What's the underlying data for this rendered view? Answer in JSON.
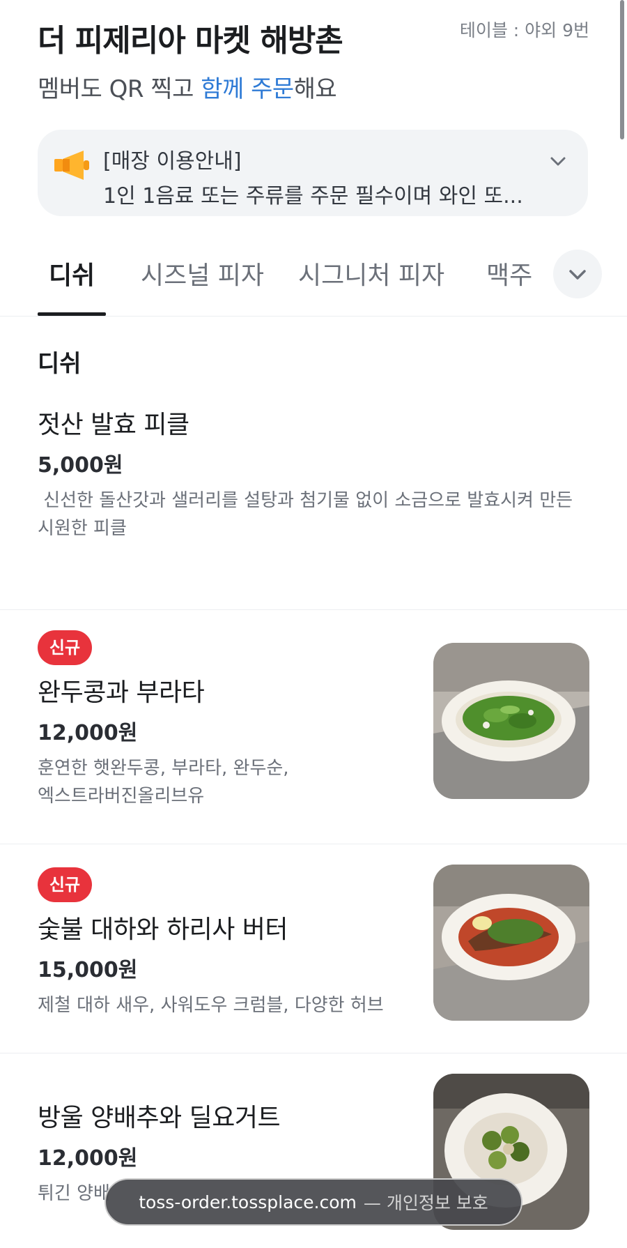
{
  "store": {
    "name": "더 피제리아 마켓 해방촌",
    "table": "테이블 : 야외 9번",
    "subtitle_prefix": "멤버도 QR 찍고 ",
    "subtitle_accent": "함께 주문",
    "subtitle_suffix": "해요"
  },
  "notice": {
    "icon": "megaphone-icon",
    "heading": "[매장 이용안내]",
    "body": "1인 1음료 또는 주류를 주문 필수이며 와인 또...",
    "expand_icon": "chevron-down-icon"
  },
  "tabs": [
    {
      "label": "디쉬",
      "active": true
    },
    {
      "label": "시즈널 피자",
      "active": false
    },
    {
      "label": "시그니처 피자",
      "active": false
    },
    {
      "label": "맥주",
      "active": false
    }
  ],
  "section": {
    "title": "디쉬"
  },
  "items": [
    {
      "name": "젓산 발효 피클",
      "price": "5,000원",
      "desc_line1": " 신선한 돌산갓과 샐러리를 설탕과 첨기물 없이 소금으로 발효시켜 만든",
      "desc_line2": "시원한 피클"
    },
    {
      "badge": "신규",
      "name": "완두콩과 부라타",
      "price": "12,000원",
      "desc_line1": "훈연한 햇완두콩, 부라타, 완두순,",
      "desc_line2": "엑스트라버진올리브유"
    },
    {
      "badge": "신규",
      "name": "숯불 대하와 하리사 버터",
      "price": "15,000원",
      "desc_line1": "제철 대하 새우, 사워도우 크럼블, 다양한 허브"
    },
    {
      "name": "방울 양배추와 딜요거트",
      "price": "12,000원",
      "desc_line1": "튀긴 양배"
    }
  ],
  "browser": {
    "host": "toss-order.tossplace.com",
    "privacy": "— 개인정보 보호"
  },
  "colors": {
    "accent_blue": "#2f7bd6",
    "badge_red": "#e8333c",
    "notice_bg": "#f2f4f6"
  }
}
